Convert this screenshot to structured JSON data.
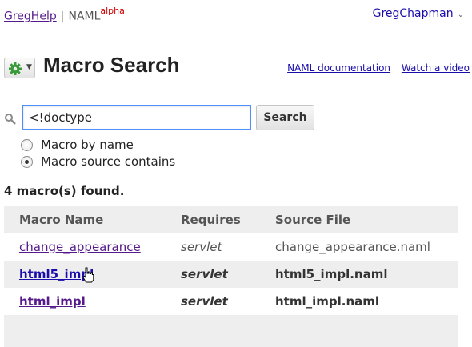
{
  "header": {
    "app_name": "GregHelp",
    "separator": "|",
    "product": "NAML",
    "product_tag": "alpha",
    "user_name": "GregChapman"
  },
  "page": {
    "title": "Macro Search",
    "links": [
      "NAML documentation",
      "Watch a video"
    ]
  },
  "search": {
    "value": "<!doctype",
    "button_label": "Search",
    "options": [
      {
        "label": "Macro by name",
        "checked": false
      },
      {
        "label": "Macro source contains",
        "checked": true
      }
    ]
  },
  "results": {
    "summary": "4 macro(s) found.",
    "columns": [
      "Macro Name",
      "Requires",
      "Source File"
    ],
    "rows": [
      {
        "name": "change_appearance",
        "requires": "servlet",
        "source": "change_appearance.naml"
      },
      {
        "name": "html5_impl",
        "requires": "servlet",
        "source": "html5_impl.naml"
      },
      {
        "name": "html_impl",
        "requires": "servlet",
        "source": "html_impl.naml"
      }
    ]
  },
  "icons": {
    "gear": "gear-icon",
    "search": "magnifier-icon"
  },
  "colors": {
    "link": "#1a0dab",
    "visited": "#551a8b",
    "alpha": "#cc0000",
    "gear_green": "#3a9a3a",
    "input_border": "#4d90fe"
  }
}
